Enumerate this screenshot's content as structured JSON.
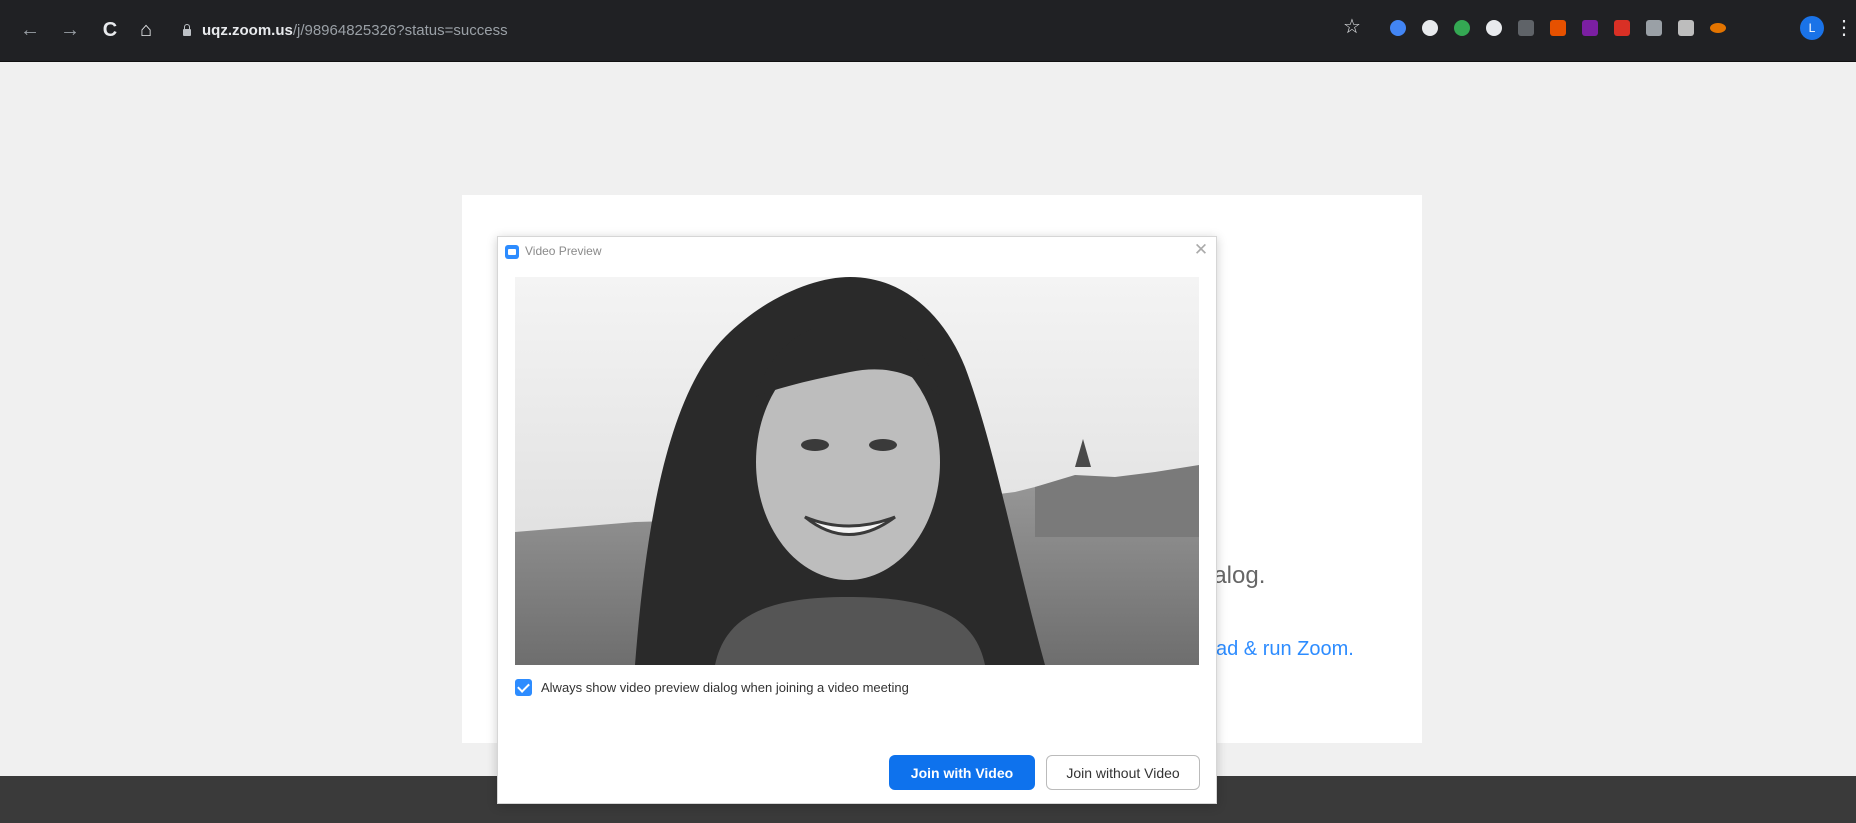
{
  "browser": {
    "back_icon": "←",
    "forward_icon": "→",
    "reload_icon": "C",
    "home_icon": "⌂",
    "url_host": "uqz.zoom.us",
    "url_path": "/j/98964825326?status=success",
    "star_icon": "☆",
    "profile_initial": "L",
    "menu_icon": "⋮",
    "extension_colors": [
      "#4285f4",
      "#e8eaed",
      "#34a853",
      "#e8eaed",
      "#5f6368",
      "#e65100",
      "#7b1fa2",
      "#d93025",
      "#9aa0a6",
      "#bdbdbd",
      "#e37400"
    ]
  },
  "page": {
    "background_text": "ialog.",
    "background_link": "ad & run Zoom."
  },
  "dialog": {
    "title": "Video Preview",
    "close_icon": "✕",
    "checkbox_label": "Always show video preview dialog when joining a video meeting",
    "checkbox_checked": true,
    "join_with_video": "Join with Video",
    "join_without_video": "Join without Video"
  },
  "colors": {
    "accent": "#0e72ed",
    "zoom_blue": "#2d8cff",
    "footer": "#3a3a3a"
  }
}
